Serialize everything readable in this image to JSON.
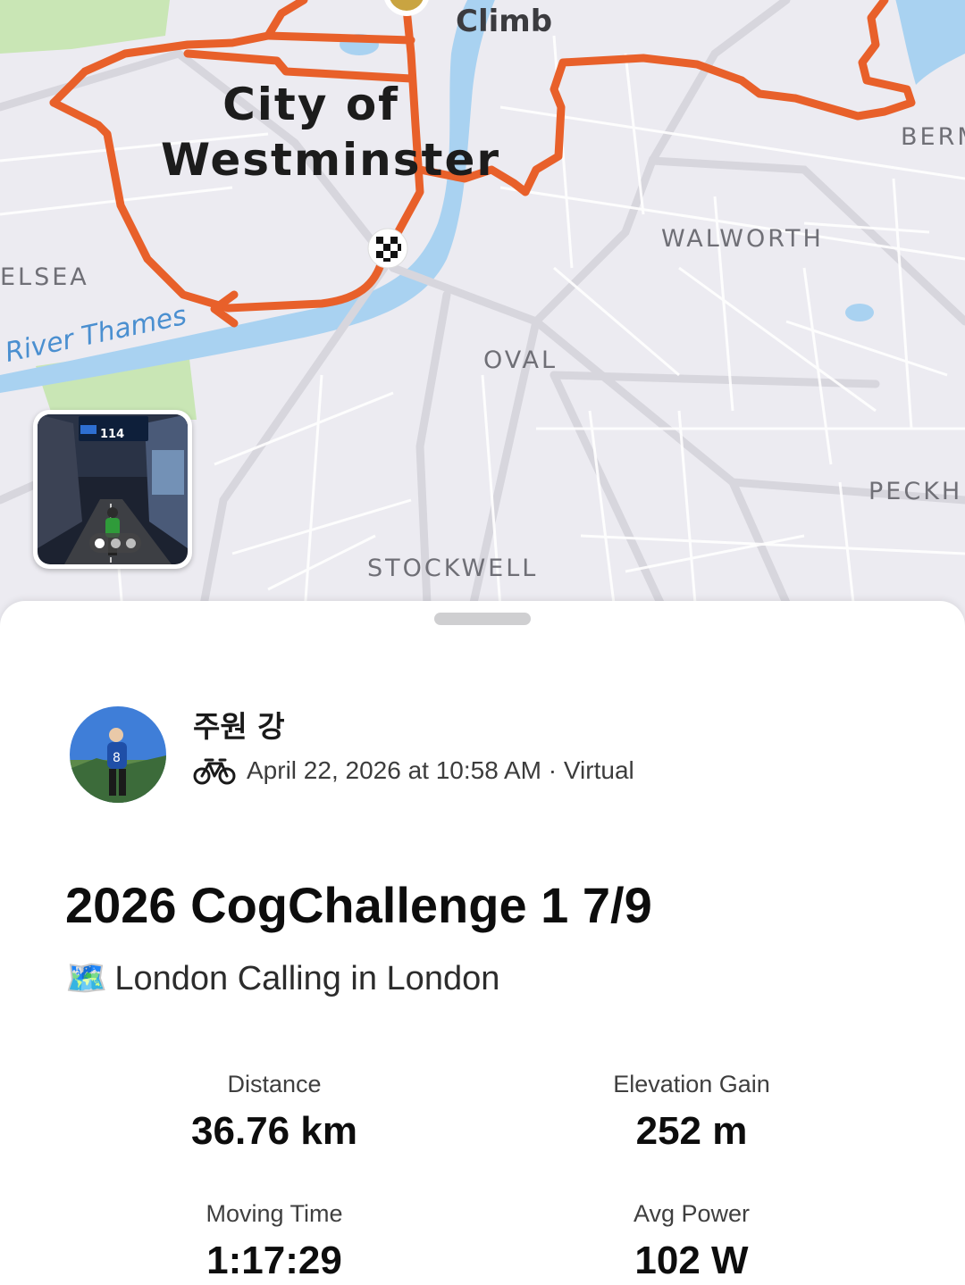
{
  "map": {
    "labels": {
      "climb": "Climb",
      "city_line1": "City of",
      "city_line2": "Westminster",
      "berm": "BERM",
      "walworth": "WALWORTH",
      "chelsea": "ELSEA",
      "river": "River Thames",
      "oval": "OVAL",
      "peckham": "PECKH",
      "stockwell": "STOCKWELL"
    },
    "route_color": "#e8602a",
    "water_color": "#a9d2f1",
    "park_color": "#c9e6b5",
    "photo_indicator": {
      "count": 3,
      "active_index": 0
    }
  },
  "activity": {
    "athlete_name": "주원 강",
    "sport_icon": "bike-icon",
    "meta": "April 22, 2026 at 10:58 AM · Virtual",
    "title": "2026 CogChallenge 1 7/9",
    "subtitle_emoji": "🗺️",
    "subtitle": "London Calling in London",
    "stats": [
      {
        "label": "Distance",
        "value": "36.76 km"
      },
      {
        "label": "Elevation Gain",
        "value": "252 m"
      },
      {
        "label": "Moving Time",
        "value": "1:17:29"
      },
      {
        "label": "Avg Power",
        "value": "102 W"
      }
    ]
  }
}
